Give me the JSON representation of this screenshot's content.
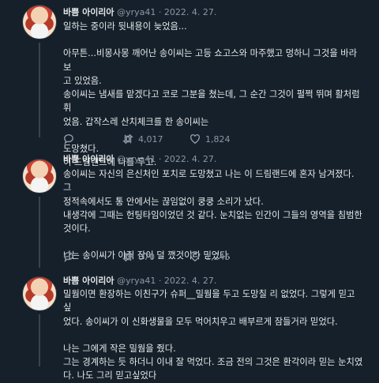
{
  "tweets": [
    {
      "author": "바쁨 아이리아",
      "handle": "@yrya41",
      "sep": "·",
      "date": "2022. 4. 27.",
      "lines": [
        "일하는 중이라 뒷내용이 늦었음...",
        "",
        "아무튼...비몽사몽 깨어난 송이씨는 고등 쇼고스와 마주했고 멍하니 그것을 바라보",
        "고 있었음.",
        "송이씨는 냄새를 맡겠다고 코로 그분을 쳤는데, 그 순간 그것이 펄쩍 뛰며 활처럼 휘",
        "었음. 갑작스레 산치체크를 한 송이씨는",
        "",
        "도망쳤다.",
        "이 드림랜드에 나를 두고."
      ],
      "retweets": "4,017",
      "likes": "1,824"
    },
    {
      "author": "바쁨 아이리아",
      "handle": "@yrya41",
      "sep": "·",
      "date": "2022. 4. 27.",
      "lines": [
        "송이씨는 자신의 은신처인 포치로 도망쳤고 나는 이 드림랜드에 혼자 남겨졌다. 그",
        "정적속에서도 통 안에서는 끊임없이 쿵쿵 소리가 났다.",
        "내생각에 그때는 헌팅타임이었던 것 같다. 눈치없는 인간이 그들의 영역을 침범한",
        "것이다.",
        "",
        "나는 송이씨가 아직 잠이 덜 깼것이라 믿었다."
      ],
      "retweets": "870",
      "likes": "1,245"
    },
    {
      "author": "바쁨 아이리아",
      "handle": "@yrya41",
      "sep": "·",
      "date": "2022. 4. 27.",
      "lines": [
        "밀웜이면 환장하는 이친구가 슈퍼__밀웜을 두고 도망칠 리 없었다. 그렇게 믿고 싶",
        "었다. 송이씨가 이 신화생물을 모두 먹어치우고 배부르게 잠들거라 믿었다.",
        "",
        "나는 그에게 작은 밀웜을 줬다.",
        "그는 경계하는 듯 하더니 이내 잘 먹었다. 조금 전의 그것은 환각이라 믿는 눈치였",
        "다. 나도 그리 믿고싶었다"
      ]
    }
  ],
  "icons": {
    "comment": "comment-icon",
    "retweet": "retweet-icon",
    "like": "heart-icon"
  }
}
